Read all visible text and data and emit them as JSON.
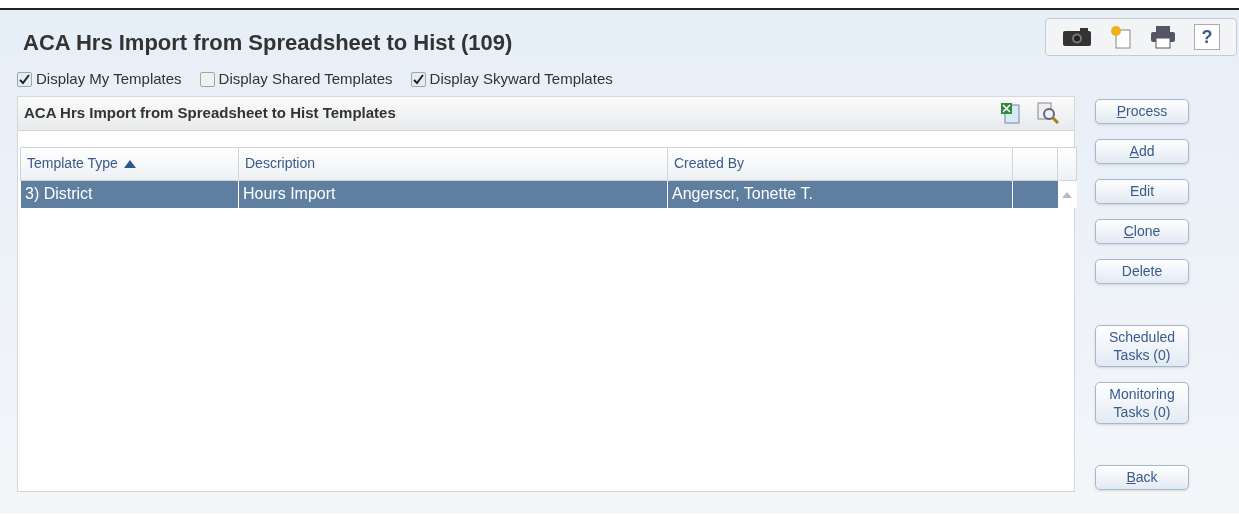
{
  "window": {
    "title": "ACA Hrs Import from Spreadsheet to Hist (109)"
  },
  "filters": [
    {
      "label": "Display My Templates",
      "checked": true
    },
    {
      "label": "Display Shared Templates",
      "checked": false
    },
    {
      "label": "Display Skyward Templates",
      "checked": true
    }
  ],
  "panel": {
    "title": "ACA Hrs Import from Spreadsheet to Hist Templates"
  },
  "table": {
    "columns": [
      {
        "label": "Template Type",
        "sorted": true
      },
      {
        "label": "Description",
        "sorted": false
      },
      {
        "label": "Created By",
        "sorted": false
      }
    ],
    "rows": [
      {
        "cells": [
          "3) District",
          "Hours Import",
          "Angerscr, Tonette T."
        ],
        "selected": true
      }
    ]
  },
  "buttons": [
    {
      "label": "Process",
      "mnemonic": true,
      "kind": "button"
    },
    {
      "label": "Add",
      "mnemonic": true,
      "kind": "button"
    },
    {
      "label": "Edit",
      "mnemonic": false,
      "kind": "button"
    },
    {
      "label": "Clone",
      "mnemonic": true,
      "kind": "button"
    },
    {
      "label": "Delete",
      "mnemonic": false,
      "kind": "button"
    },
    {
      "kind": "gap"
    },
    {
      "label": "Scheduled Tasks (0)",
      "mnemonic": false,
      "kind": "button"
    },
    {
      "label": "Monitoring Tasks (0)",
      "mnemonic": false,
      "kind": "button"
    },
    {
      "kind": "gap"
    },
    {
      "label": "Back",
      "mnemonic": true,
      "kind": "button"
    }
  ],
  "toolbar": {
    "help": "?"
  }
}
